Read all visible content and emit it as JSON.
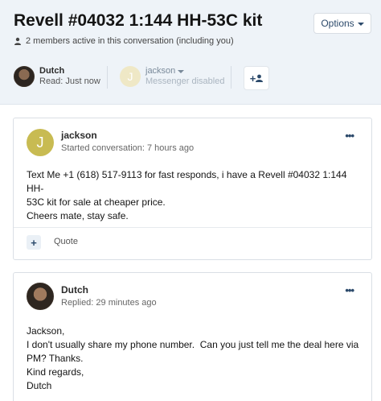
{
  "thread": {
    "title": "Revell #04032 1:144 HH-53C kit",
    "options_label": "Options",
    "members_text": "2 members active in this conversation (including you)",
    "add_label": "+"
  },
  "participants": [
    {
      "name": "Dutch",
      "status": "Read: Just now"
    },
    {
      "name": "jackson",
      "status": "Messenger disabled",
      "initial": "J"
    }
  ],
  "messages": [
    {
      "author": "jackson",
      "initial": "J",
      "meta": "Started conversation: 7 hours ago",
      "lines": [
        "Text Me +1 (618) 517-9113 for fast responds, i have a Revell #04032 1:144 HH-",
        "53C kit for sale at cheaper price.",
        "Cheers mate, stay safe."
      ],
      "plus_label": "+",
      "quote_label": "Quote"
    },
    {
      "author": "Dutch",
      "meta": "Replied: 29 minutes ago",
      "lines": [
        "Jackson,",
        "I don't usually share my phone number.  Can you just tell me the deal here via",
        "PM? Thanks.",
        "Kind regards,",
        "Dutch"
      ]
    }
  ],
  "more_label": "•••",
  "colors": {
    "accent": "#2c4a6b",
    "header_bg": "#eef3f8",
    "avatar_j": "#c8bb52"
  }
}
